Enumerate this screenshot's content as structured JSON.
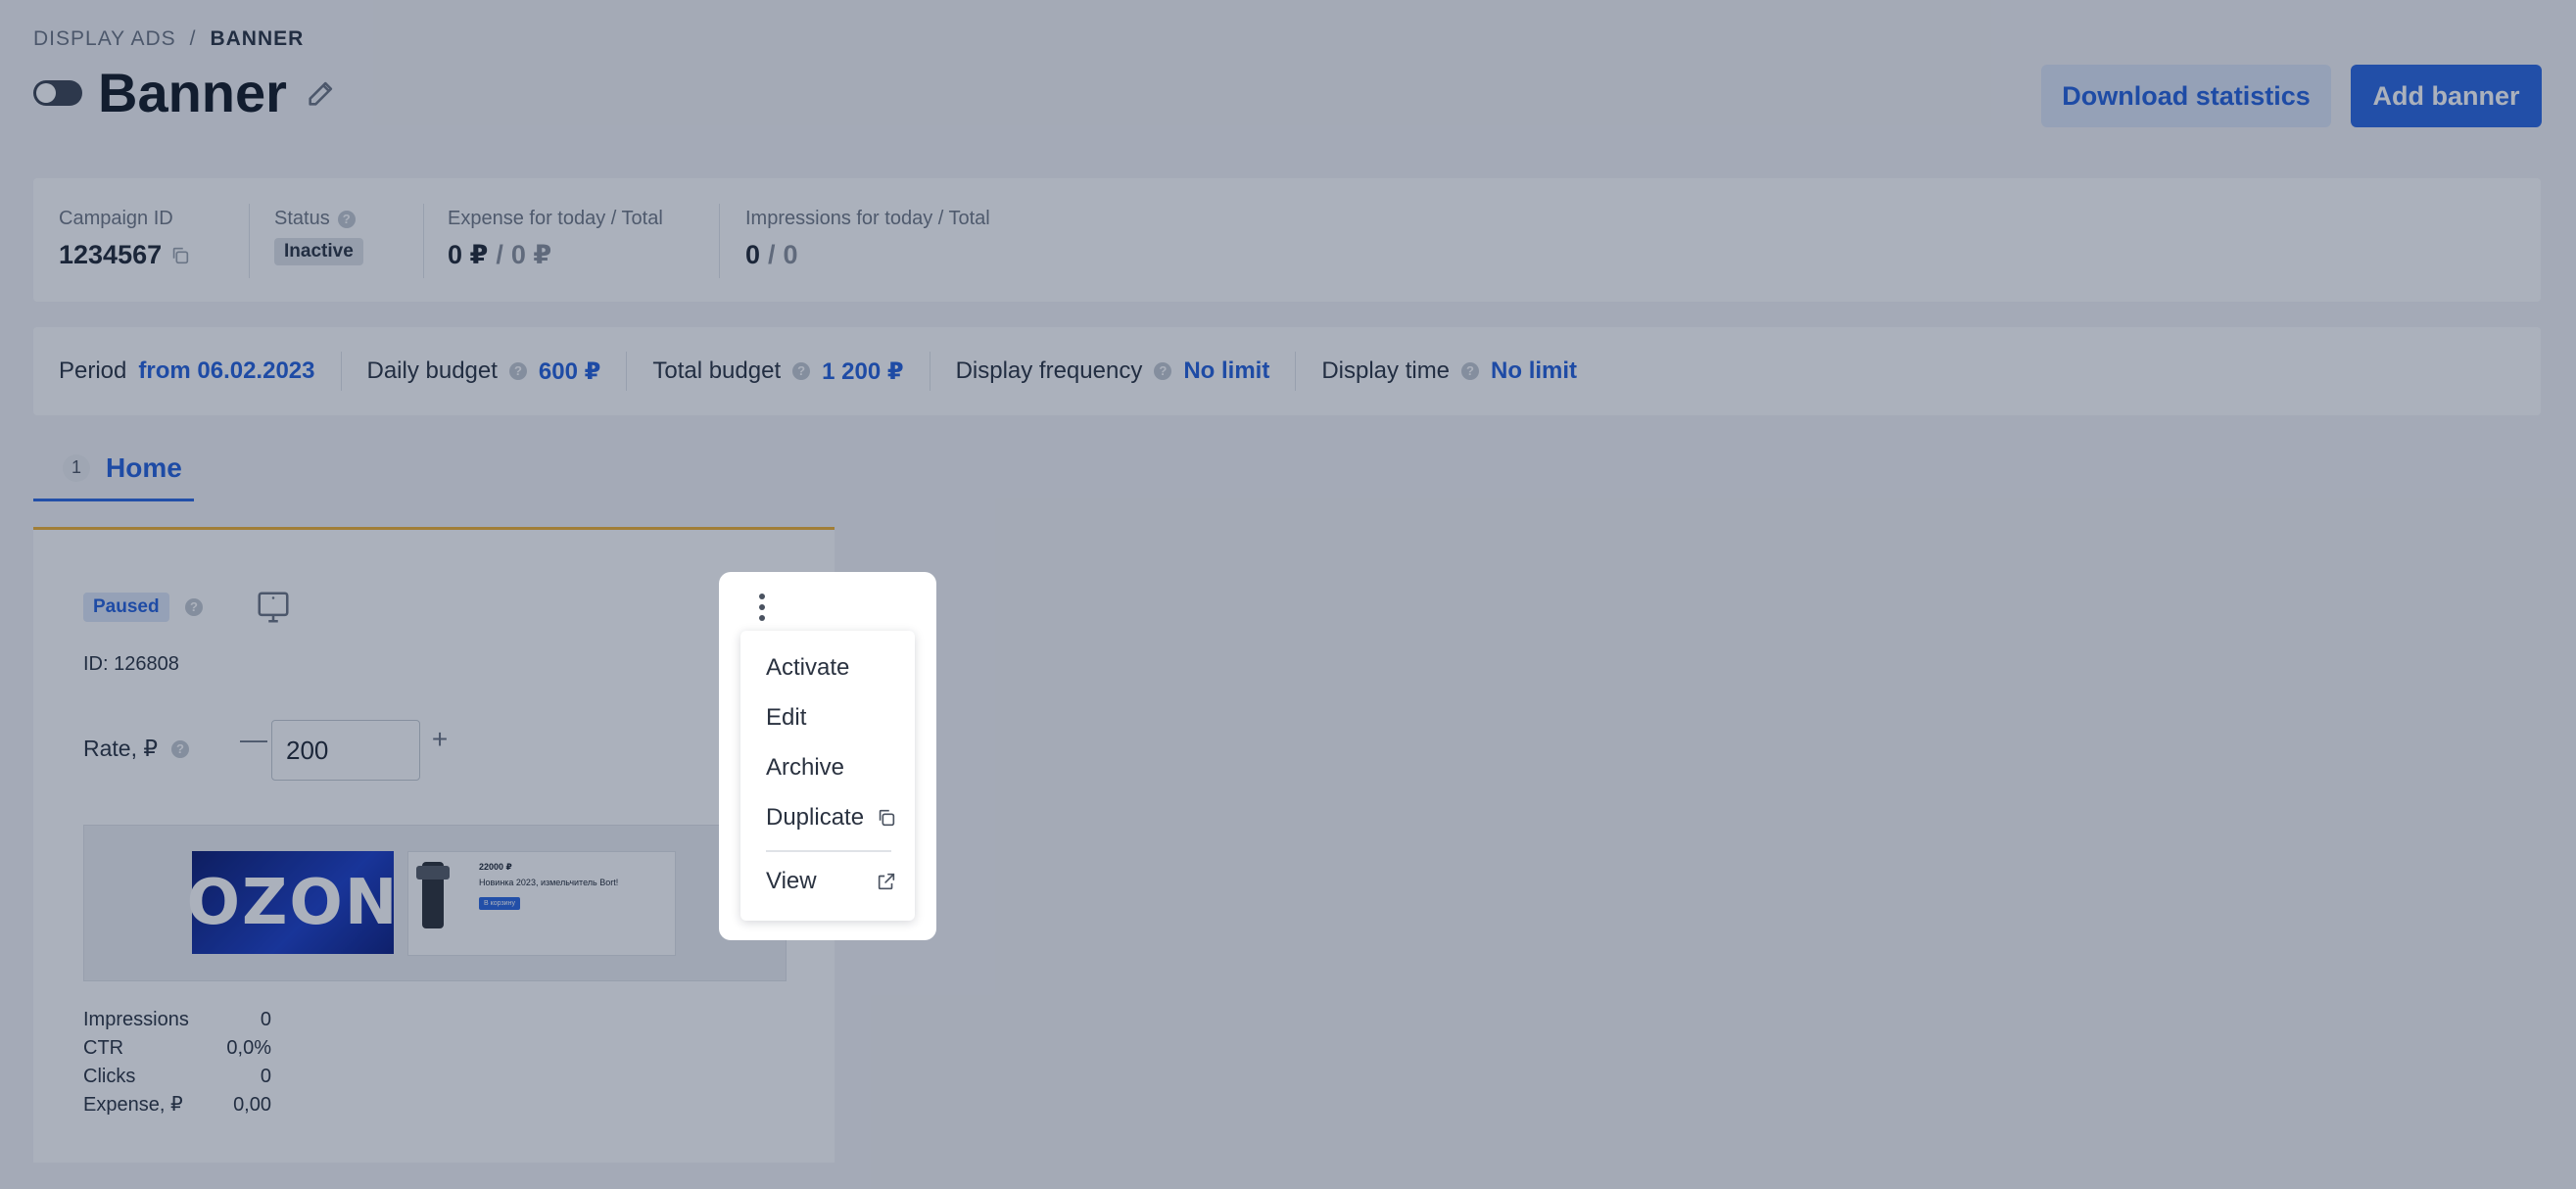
{
  "breadcrumb": {
    "parent": "DISPLAY ADS",
    "separator": "/",
    "current": "BANNER"
  },
  "header": {
    "title": "Banner",
    "download_label": "Download statistics",
    "add_label": "Add banner"
  },
  "stats": {
    "campaign_id_label": "Campaign ID",
    "campaign_id": "1234567",
    "status_label": "Status",
    "status_value": "Inactive",
    "expense_label": "Expense for today / Total",
    "expense_today": "0 ₽",
    "expense_sep": "/",
    "expense_total": "0 ₽",
    "impressions_label": "Impressions for today / Total",
    "impressions_today": "0",
    "impressions_sep": "/",
    "impressions_total": "0"
  },
  "settings": {
    "period_label": "Period",
    "period_value": "from 06.02.2023",
    "daily_label": "Daily budget",
    "daily_value": "600 ₽",
    "total_label": "Total budget",
    "total_value": "1 200 ₽",
    "freq_label": "Display frequency",
    "freq_value": "No limit",
    "time_label": "Display time",
    "time_value": "No limit"
  },
  "tab": {
    "count": "1",
    "label": "Home"
  },
  "banner": {
    "status": "Paused",
    "id_text": "ID: 126808",
    "rate_label": "Rate, ₽",
    "rate_value": "200",
    "minus": "—",
    "plus": "+",
    "preview": {
      "logo": "OZON",
      "price": "22000 ₽",
      "headline": "Новинка 2023, измельчитель Bort!",
      "cta": "В корзину"
    },
    "metrics": [
      {
        "label": "Impressions",
        "value": "0"
      },
      {
        "label": "CTR",
        "value": "0,0%"
      },
      {
        "label": "Clicks",
        "value": "0"
      },
      {
        "label": "Expense, ₽",
        "value": "0,00"
      }
    ]
  },
  "menu": {
    "activate": "Activate",
    "edit": "Edit",
    "archive": "Archive",
    "duplicate": "Duplicate",
    "view": "View"
  },
  "icons": {
    "help": "question-circle-icon",
    "edit": "pencil-icon",
    "copy": "copy-icon",
    "desktop": "desktop-icon",
    "external": "external-link-icon",
    "more": "kebab-icon"
  },
  "colors": {
    "accent": "#2a66e0",
    "accent_text": "#2360dc",
    "card_accent": "#f0b030"
  }
}
